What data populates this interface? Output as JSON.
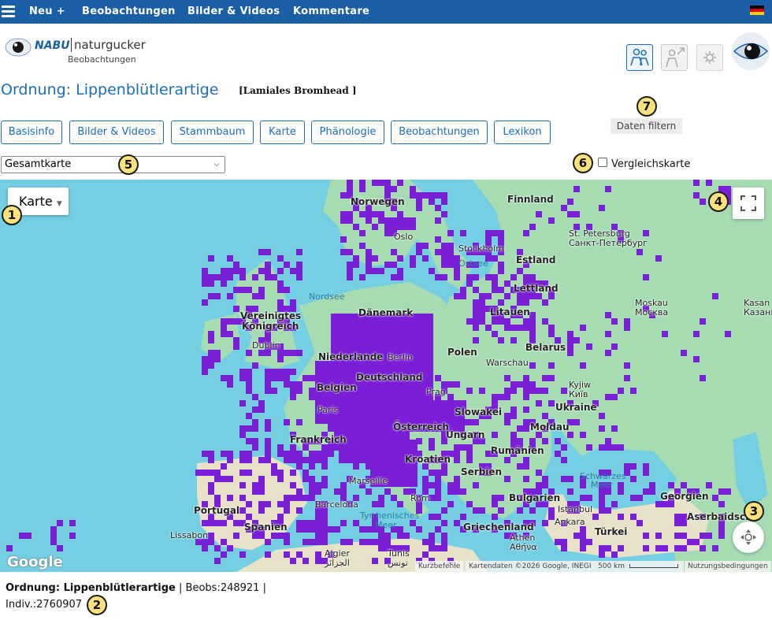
{
  "topnav": {
    "items": [
      {
        "id": "neu",
        "label": "Neu +"
      },
      {
        "id": "beobachtungen",
        "label": "Beobachtungen"
      },
      {
        "id": "bilder",
        "label": "Bilder & Videos"
      },
      {
        "id": "kommentare",
        "label": "Kommentare"
      }
    ],
    "language_flag": "de-flag-icon"
  },
  "logo": {
    "brand": "NABU",
    "product": "naturgucker",
    "sub": "Beobachtungen"
  },
  "header_icons": [
    "people-icon",
    "user-share-icon",
    "settings-icon",
    "naturgucker-eye-icon"
  ],
  "page_title": "Ordnung: Lippenblütlerartige",
  "latin_name": "[Lamiales Bromhead ]",
  "tabs": [
    "Basisinfo",
    "Bilder & Videos",
    "Stammbaum",
    "Karte",
    "Phänologie",
    "Beobachtungen",
    "Lexikon"
  ],
  "filter_button": "Daten filtern",
  "map_select": {
    "value": "Gesamtkarte"
  },
  "compare_checkbox": {
    "label": "Vergleichskarte",
    "checked": false
  },
  "map": {
    "type_button": "Karte",
    "google_logo": "Google",
    "attribution": {
      "shortcuts": "Kurzbefehle",
      "data": "Kartendaten ©2026 Google, INEGI",
      "scale": "500 km",
      "terms": "Nutzungsbedingungen"
    },
    "labels": {
      "finnland": "Finnland",
      "norwegen": "Norwegen",
      "oslo": "Oslo",
      "stockholm": "Stockholm",
      "ostsee": "Ostsee",
      "estland": "Estland",
      "lettland": "Lettland",
      "litauen": "Litauen",
      "stpete": "St. Petersburg",
      "stpete_ru": "Санкт-Петербург",
      "moskau": "Moskau",
      "moskau_ru": "Москва",
      "kasan": "Kasan",
      "kasan_ru": "Казань",
      "nordsee": "Nordsee",
      "uk": "Vereinigtes",
      "uk2": "Königreich",
      "dublin": "Dublin",
      "daenemark": "Dänemark",
      "niederlande": "Niederlande",
      "berlin": "Berlin",
      "deutschland": "Deutschland",
      "belgien": "Belgien",
      "paris": "Paris",
      "prag": "Prag",
      "polen": "Polen",
      "warschau": "Warschau",
      "belarus": "Belarus",
      "kyjiw": "Kyjiw",
      "kyjiw_ua": "Київ",
      "ukraine": "Ukraine",
      "slowakei": "Slowakei",
      "moldau": "Moldau",
      "oesterreich": "Österreich",
      "ungarn": "Ungarn",
      "rumaenien": "Rumänien",
      "frankreich": "Frankreich",
      "kroatien": "Kroatien",
      "serbien": "Serbien",
      "schwarzes": "Schwarzes",
      "meer": "Meer",
      "bulgarien": "Bulgarien",
      "istanbul": "Istanbul",
      "ankara": "Ankara",
      "tuerkei": "Türkei",
      "marseille": "Marseille",
      "rom": "Rom",
      "barcelona": "Barcelona",
      "tyrrhen": "Tyrrhenisches",
      "tyrrhen2": "Meer",
      "portugal": "Portugal",
      "spanien": "Spanien",
      "lissabon": "Lissabon",
      "griechenland": "Griechenland",
      "athen": "Athen",
      "athen_gr": "Αθήνα",
      "georgien": "Georgien",
      "aserbaidsch": "Aserbaidsch",
      "algier": "Algier",
      "algier_ar": "الجزائر",
      "tunis": "Tunis",
      "tunis_ar": "تونس"
    }
  },
  "summary": {
    "title": "Ordnung: Lippenblütlerartige",
    "beobs": "| Beobs:248921 |",
    "indiv": "Indiv.:2760907"
  },
  "badges": [
    "1",
    "2",
    "3",
    "4",
    "5",
    "6",
    "7"
  ],
  "colors": {
    "nav_bg": "#1a5fa6",
    "link": "#1a6eb8",
    "observation_cell": "#7a1fd6",
    "sea": "#74cfe3",
    "land": "#a7dcb3",
    "badge": "#f9e17c"
  }
}
